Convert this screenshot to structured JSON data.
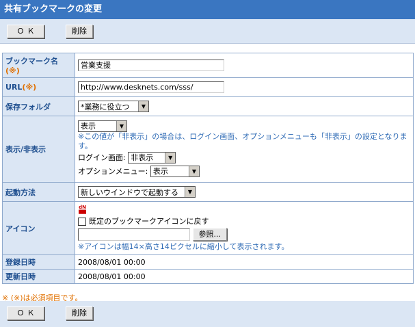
{
  "title": "共有ブックマークの変更",
  "buttons": {
    "ok": "ＯＫ",
    "delete": "削除"
  },
  "rows": {
    "bookmark_name": {
      "label": "ブックマーク名",
      "req": "(※)",
      "value": "営業支援"
    },
    "url": {
      "label": "URL",
      "req": "(※)",
      "value": "http://www.desknets.com/sss/"
    },
    "folder": {
      "label": "保存フォルダ",
      "value": "*業務に役立つ"
    },
    "visibility": {
      "label": "表示/非表示",
      "value": "表示",
      "note": "※この値が「非表示」の場合は、ログイン画面、オプションメニューも「非表示」の設定となります。",
      "login_label": "ログイン画面:",
      "login_value": "非表示",
      "option_label": "オプションメニュー:",
      "option_value": "表示"
    },
    "launch": {
      "label": "起動方法",
      "value": "新しいウインドウで起動する"
    },
    "icon": {
      "label": "アイコン",
      "checkbox_label": "既定のブックマークアイコンに戻す",
      "file_value": "",
      "browse_label": "参照...",
      "note": "※アイコンは幅14×高さ14ピクセルに縮小して表示されます。"
    },
    "registered": {
      "label": "登録日時",
      "value": "2008/08/01 00:00"
    },
    "updated": {
      "label": "更新日時",
      "value": "2008/08/01 00:00"
    }
  },
  "footnote": "※ (※)は必須項目です。",
  "colors": {
    "titlebar": "#3a76c1",
    "label_bg": "#dbe6f4",
    "label_text": "#1f4f8f",
    "required": "#e07000",
    "note": "#2d6ab5"
  }
}
